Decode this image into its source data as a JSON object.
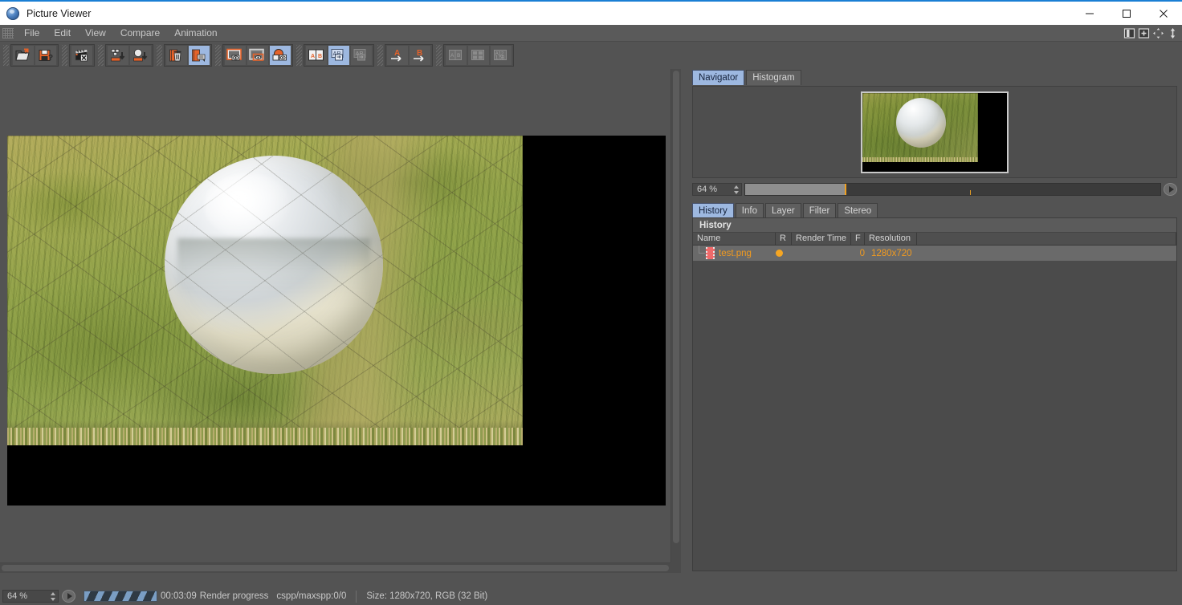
{
  "window": {
    "title": "Picture Viewer",
    "app_icon": "sphere-logo-icon",
    "controls": {
      "minimize": "minimize-icon",
      "maximize": "maximize-icon",
      "close": "close-icon"
    }
  },
  "menubar": {
    "grip": "drag-grip-icon",
    "items": [
      "File",
      "Edit",
      "View",
      "Compare",
      "Animation"
    ],
    "right_icons": [
      "split-layout-icon",
      "add-view-icon",
      "move-icon",
      "resize-vertical-icon"
    ]
  },
  "toolbar": {
    "groups": [
      {
        "name": "file-group",
        "buttons": [
          {
            "name": "open-image-button",
            "icon": "open-folder-icon",
            "active": false
          },
          {
            "name": "save-image-button",
            "icon": "save-disk-question-icon",
            "active": false
          }
        ]
      },
      {
        "name": "movie-group",
        "buttons": [
          {
            "name": "delete-movie-button",
            "icon": "film-clapper-x-icon",
            "active": false
          }
        ]
      },
      {
        "name": "load-group",
        "buttons": [
          {
            "name": "load-multipass-button",
            "icon": "multipass-down-icon",
            "active": false
          },
          {
            "name": "load-object-button",
            "icon": "sphere-down-icon",
            "active": false
          }
        ]
      },
      {
        "name": "history-group",
        "buttons": [
          {
            "name": "delete-history-button",
            "icon": "trash-image-icon",
            "active": false
          },
          {
            "name": "history-settings-button",
            "icon": "image-list-icon",
            "active": true
          }
        ]
      },
      {
        "name": "view-group",
        "buttons": [
          {
            "name": "view-a-button",
            "icon": "frame-eye-a-icon",
            "active": false
          },
          {
            "name": "view-b-button",
            "icon": "frame-eye-b-icon",
            "active": false
          },
          {
            "name": "view-single-button",
            "icon": "sphere-eye-icon",
            "active": true
          }
        ]
      },
      {
        "name": "compare-group",
        "buttons": [
          {
            "name": "compare-side-by-side-button",
            "icon": "ab-split-icon",
            "active": false
          },
          {
            "name": "compare-blend-button",
            "icon": "ab-blend-icon",
            "active": true
          },
          {
            "name": "compare-difference-button",
            "icon": "ab-diff-icon",
            "active": false
          }
        ]
      },
      {
        "name": "assign-group",
        "buttons": [
          {
            "name": "set-a-button",
            "icon": "arrow-to-a-icon",
            "active": false
          },
          {
            "name": "set-b-button",
            "icon": "arrow-to-b-icon",
            "active": false
          }
        ]
      },
      {
        "name": "layout-group",
        "buttons": [
          {
            "name": "layout-ab-button",
            "icon": "layout-ab-icon",
            "active": false
          },
          {
            "name": "layout-grid-button",
            "icon": "layout-grid-icon",
            "active": false
          },
          {
            "name": "layout-multi-button",
            "icon": "layout-multi-icon",
            "active": false
          }
        ]
      }
    ]
  },
  "navigator": {
    "tabs": [
      {
        "label": "Navigator",
        "active": true
      },
      {
        "label": "Histogram",
        "active": false
      }
    ],
    "zoom_value": "64 %",
    "timeline_fill_percent": 24,
    "playhead_percent": 24,
    "marker_percent": 54,
    "play_button": "play-icon"
  },
  "details": {
    "tabs": [
      {
        "label": "History",
        "active": true
      },
      {
        "label": "Info",
        "active": false
      },
      {
        "label": "Layer",
        "active": false
      },
      {
        "label": "Filter",
        "active": false
      },
      {
        "label": "Stereo",
        "active": false
      }
    ],
    "section_title": "History",
    "columns": [
      "Name",
      "R",
      "Render Time",
      "F",
      "Resolution"
    ],
    "rows": [
      {
        "name": "test.png",
        "icon": "film-strip-icon",
        "render_status": "render-dot-icon",
        "render_time": "",
        "frames": "0",
        "resolution": "1280x720",
        "selected": true
      }
    ]
  },
  "statusbar": {
    "zoom_value": "64 %",
    "play_button": "play-icon",
    "progress_icon": "render-progress-stripes",
    "elapsed": "00:03:09",
    "progress_label": "Render progress",
    "sampling": "cspp/maxspp:0/0",
    "size_info": "Size: 1280x720, RGB (32 Bit)"
  },
  "colors": {
    "accent_blue": "#1a7fd4",
    "tab_active": "#9db8e0",
    "highlight_orange": "#f09a20",
    "panel_bg": "#535353",
    "toolbar_orange": "#e4622a"
  }
}
